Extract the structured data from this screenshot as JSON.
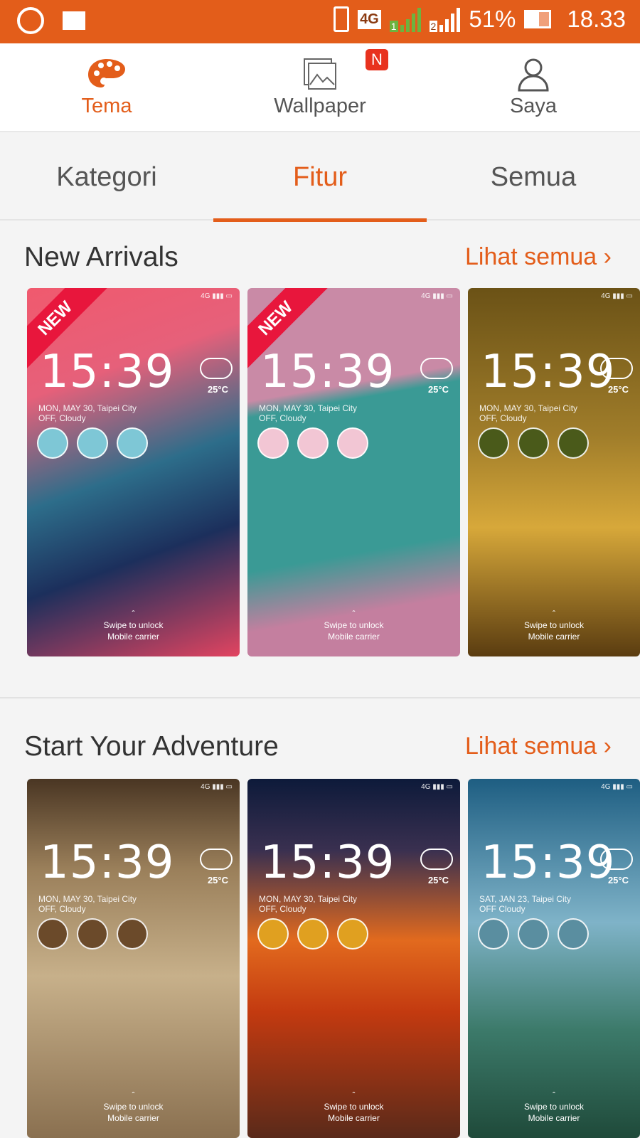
{
  "status_bar": {
    "battery": "51%",
    "time": "18.33",
    "network": "4G",
    "sim1": "1",
    "sim2": "2",
    "battery_level": 0.51,
    "icons": [
      "whatsapp-icon",
      "gallery-icon",
      "vibrate-icon",
      "signal-icon",
      "battery-icon"
    ]
  },
  "nav": {
    "items": [
      {
        "label": "Tema",
        "icon": "palette-icon",
        "active": true
      },
      {
        "label": "Wallpaper",
        "icon": "wallpaper-icon",
        "badge": "N"
      },
      {
        "label": "Saya",
        "icon": "person-icon"
      }
    ]
  },
  "subtabs": [
    {
      "label": "Kategori"
    },
    {
      "label": "Fitur",
      "active": true
    },
    {
      "label": "Semua"
    }
  ],
  "accent": "#e35d1a",
  "sections": [
    {
      "title": "New Arrivals",
      "more": "Lihat semua",
      "cards": [
        {
          "new": "NEW",
          "time": "15:39",
          "temp": "25°C",
          "date": "MON, MAY 30, Taipei City",
          "alarm": "OFF, Cloudy",
          "swipe": "Swipe to unlock",
          "carrier": "Mobile carrier",
          "bg": "linear-gradient(160deg,#f05a6e 0%,#e6607a 25%,#2d6d8a 50%,#1c2f5c 70%,#e24460 100%)",
          "app": "#7ec7d6"
        },
        {
          "new": "NEW",
          "time": "15:39",
          "temp": "25°C",
          "date": "MON, MAY 30, Taipei City",
          "alarm": "OFF, Cloudy",
          "swipe": "Swipe to unlock",
          "carrier": "Mobile carrier",
          "bg": "linear-gradient(170deg,#c98aa6 0%,#c98aa6 28%,#3a9a95 32%,#3a9a95 70%,#c47f9f 85%)",
          "app": "#f2c6d4"
        },
        {
          "time": "15:39",
          "temp": "25°C",
          "date": "MON, MAY 30, Taipei City",
          "alarm": "OFF, Cloudy",
          "swipe": "Swipe to unlock",
          "carrier": "Mobile carrier",
          "bg": "linear-gradient(180deg,#6b5216 0%,#a07d2a 40%,#d7a83a 65%,#5a3c10 100%)",
          "app": "#4a5a1a"
        }
      ]
    },
    {
      "title": "Start Your Adventure",
      "more": "Lihat semua",
      "cards": [
        {
          "time": "15:39",
          "temp": "25°C",
          "date": "MON, MAY 30, Taipei City",
          "alarm": "OFF, Cloudy",
          "swipe": "Swipe to unlock",
          "carrier": "Mobile carrier",
          "bg": "linear-gradient(180deg,#4a3623 0%,#9a7f5a 25%,#c7b08a 55%,#8a7050 100%)",
          "app": "#6b4a2a"
        },
        {
          "time": "15:39",
          "temp": "25°C",
          "date": "MON, MAY 30, Taipei City",
          "alarm": "OFF, Cloudy",
          "swipe": "Swipe to unlock",
          "carrier": "Mobile carrier",
          "bg": "linear-gradient(180deg,#0d1a3a 0%,#3a3050 20%,#e26a1e 45%,#c33a10 65%,#5a2a1a 100%)",
          "app": "#e0a020"
        },
        {
          "time": "15:39",
          "temp": "25°C",
          "date": "SAT, JAN 23, Taipei City",
          "alarm": "OFF Cloudy",
          "swipe": "Swipe to unlock",
          "carrier": "Mobile carrier",
          "bg": "linear-gradient(180deg,#1e5e82 0%,#7fb3c8 40%,#3c7a6a 70%,#1f4a3a 100%)",
          "app": "#5a8ea0"
        }
      ]
    }
  ]
}
